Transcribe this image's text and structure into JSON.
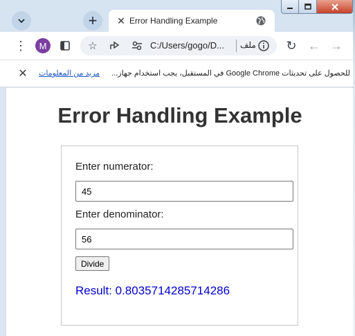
{
  "browser": {
    "tab": {
      "title": "Error Handling Example"
    },
    "address_bar": {
      "url": "C:/Users/gogo/D...",
      "scheme_label": "ملف"
    },
    "profile_initial": "M",
    "info_bar": {
      "message": "للحصول على تحديثات Google Chrome في المستقبل، يجب استخدام جهاز...",
      "link": "مزيد من المعلومات"
    }
  },
  "page": {
    "title": "Error Handling Example",
    "numerator": {
      "label": "Enter numerator:",
      "value": "45"
    },
    "denominator": {
      "label": "Enter denominator:",
      "value": "56"
    },
    "divide_button": "Divide",
    "result": "Result: 0.8035714285714286"
  },
  "colors": {
    "result_text": "#0000cc",
    "title_text": "#333333",
    "avatar": "#7b3fa0",
    "link": "#1a56c4"
  }
}
